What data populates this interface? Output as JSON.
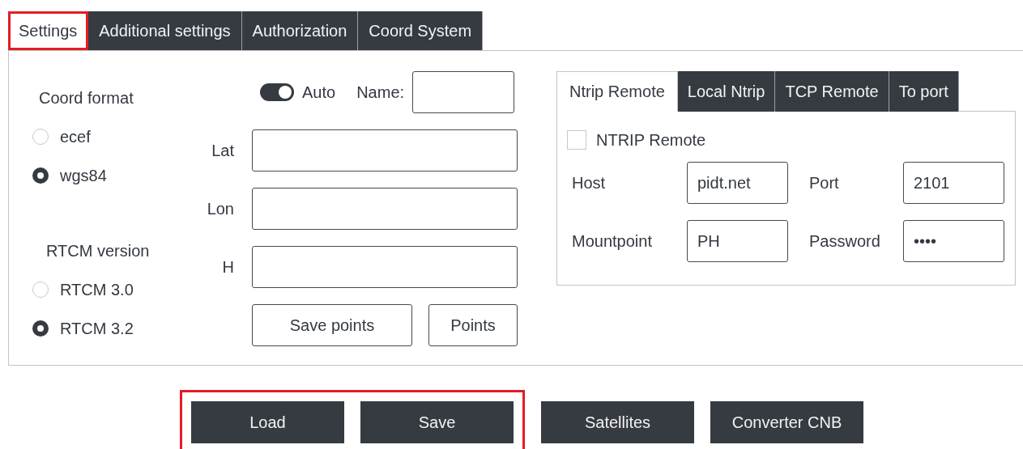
{
  "tabs": [
    {
      "label": "Settings",
      "selected": true,
      "highlighted": true
    },
    {
      "label": "Additional settings",
      "selected": false,
      "highlighted": false
    },
    {
      "label": "Authorization",
      "selected": false,
      "highlighted": false
    },
    {
      "label": "Coord System",
      "selected": false,
      "highlighted": false
    }
  ],
  "coord_format": {
    "label": "Coord format",
    "options": [
      {
        "label": "ecef",
        "selected": false
      },
      {
        "label": "wgs84",
        "selected": true
      }
    ]
  },
  "rtcm_version": {
    "label": "RTCM version",
    "options": [
      {
        "label": "RTCM 3.0",
        "selected": false
      },
      {
        "label": "RTCM 3.2",
        "selected": true
      }
    ]
  },
  "auto_toggle": {
    "label": "Auto",
    "on": true
  },
  "name_field": {
    "label": "Name:"
  },
  "coordinates": [
    {
      "label": "Lat"
    },
    {
      "label": "Lon"
    },
    {
      "label": "H"
    }
  ],
  "point_buttons": [
    "Save points",
    "Points"
  ],
  "connection": {
    "tabs": [
      {
        "label": "Ntrip Remote",
        "selected": true
      },
      {
        "label": "Local Ntrip",
        "selected": false
      },
      {
        "label": "TCP Remote",
        "selected": false
      },
      {
        "label": "To port",
        "selected": false
      }
    ],
    "enable": {
      "label": "NTRIP Remote",
      "checked": false
    },
    "fields": [
      {
        "label": "Host",
        "value": "pidt.net"
      },
      {
        "label": "Port",
        "value": "2101"
      },
      {
        "label": "Mountpoint",
        "value": "PH"
      },
      {
        "label": "Password",
        "value": "••••"
      }
    ]
  },
  "actions": {
    "highlighted_group": [
      "Load",
      "Save"
    ],
    "others": [
      "Satellites",
      "Converter CNB"
    ]
  }
}
